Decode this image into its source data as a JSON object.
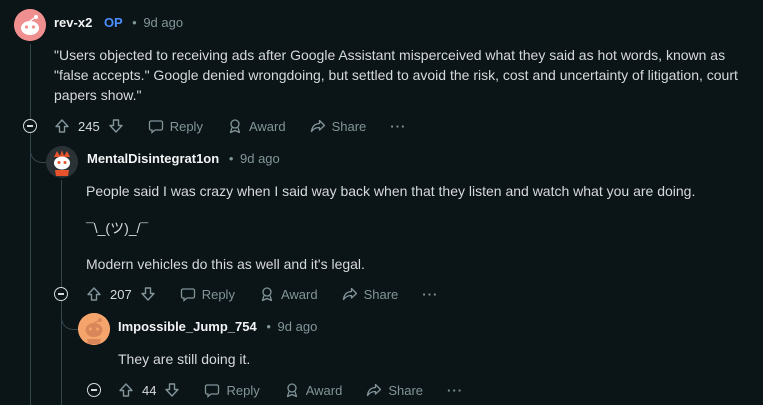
{
  "comments": [
    {
      "author": "rev-x2",
      "op_badge": "OP",
      "separator": "•",
      "time": "9d ago",
      "body": "\"Users objected to receiving ads after Google Assistant misperceived what they said as hot words, known as \"false accepts.\" Google denied wrongdoing, but settled to avoid the risk, cost and uncertainty of litigation, court papers show.\"",
      "votes": "245",
      "reply_label": "Reply",
      "award_label": "Award",
      "share_label": "Share",
      "more_label": "···"
    },
    {
      "author": "MentalDisintegrat1on",
      "separator": "•",
      "time": "9d ago",
      "paragraphs": [
        "People said I was crazy when I said way back when that they listen and watch what you are doing.",
        "¯\\_(ツ)_/¯",
        "Modern vehicles do this as well and it's legal."
      ],
      "votes": "207",
      "reply_label": "Reply",
      "award_label": "Award",
      "share_label": "Share",
      "more_label": "···"
    },
    {
      "author": "Impossible_Jump_754",
      "separator": "•",
      "time": "9d ago",
      "body": "They are still doing it.",
      "votes": "44",
      "reply_label": "Reply",
      "award_label": "Award",
      "share_label": "Share",
      "more_label": "···"
    }
  ],
  "colors": {
    "background": "#0b1416",
    "op_badge": "#4b8fff",
    "text": "#d7dadc",
    "muted": "#82959b",
    "thread_line": "#33464c"
  },
  "icons": [
    "snoo-avatar-icon",
    "collapse-icon",
    "upvote-icon",
    "downvote-icon",
    "reply-icon",
    "award-icon",
    "share-icon",
    "more-icon"
  ]
}
